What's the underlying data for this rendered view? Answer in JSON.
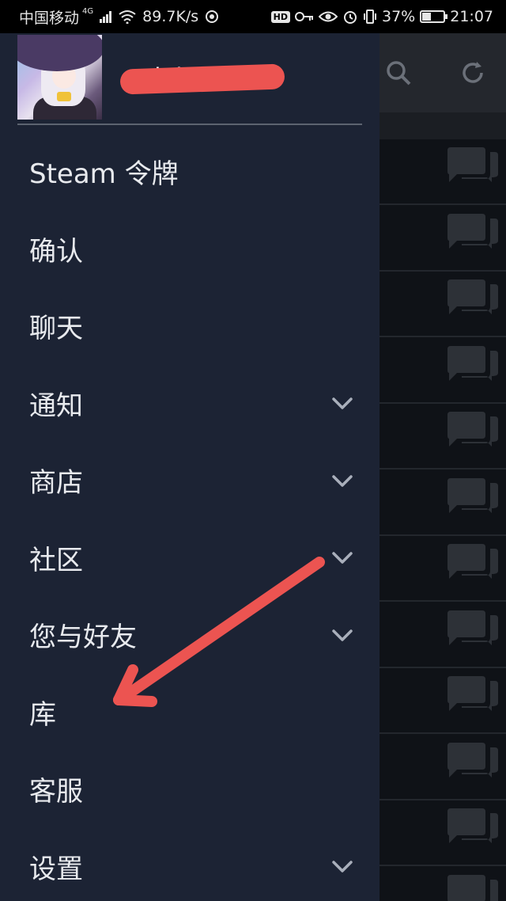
{
  "status_bar": {
    "carrier": "中国移动",
    "network": "4G",
    "speed": "89.7K/s",
    "battery": "37%",
    "battery_level": 0.37,
    "time": "21:07",
    "hd_badge": "HD"
  },
  "drawer": {
    "username": "…zhda",
    "menu": [
      {
        "label": "Steam 令牌",
        "chevron": false
      },
      {
        "label": "确认",
        "chevron": false
      },
      {
        "label": "聊天",
        "chevron": false
      },
      {
        "label": "通知",
        "chevron": true
      },
      {
        "label": "商店",
        "chevron": true
      },
      {
        "label": "社区",
        "chevron": true
      },
      {
        "label": "您与好友",
        "chevron": true
      },
      {
        "label": "库",
        "chevron": false
      },
      {
        "label": "客服",
        "chevron": false
      },
      {
        "label": "设置",
        "chevron": true
      }
    ]
  },
  "background_app": {
    "toolbar_icons": [
      "search-icon",
      "refresh-icon"
    ],
    "row_icon": "chat-icon"
  },
  "colors": {
    "drawer_bg": "#1c2334",
    "annotation_arrow": "#ec5451"
  }
}
